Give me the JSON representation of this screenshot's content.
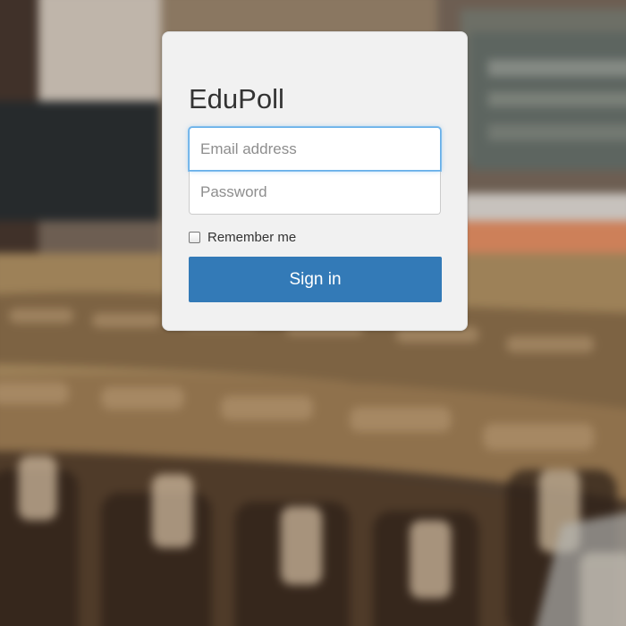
{
  "app": {
    "title": "EduPoll"
  },
  "form": {
    "email_placeholder": "Email address",
    "email_value": "",
    "password_placeholder": "Password",
    "password_value": "",
    "remember_label": "Remember me",
    "remember_checked": false,
    "submit_label": "Sign in"
  },
  "colors": {
    "card_background": "#f1f1f1",
    "primary_button": "#337ab7",
    "focus_border": "#66afe9",
    "title_text": "#333333"
  },
  "icons": {
    "checkbox": "checkbox-icon"
  }
}
